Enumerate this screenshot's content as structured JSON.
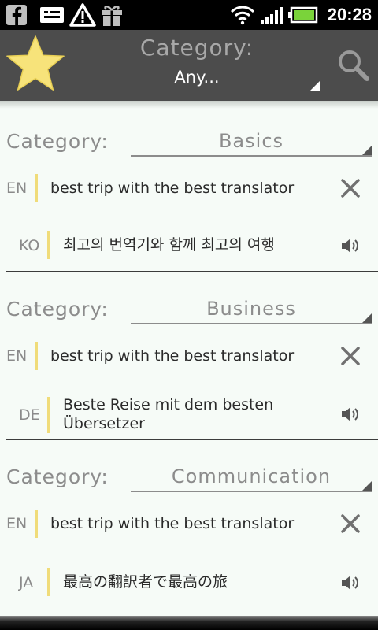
{
  "status_bar": {
    "time": "20:28",
    "icons": [
      "facebook-icon",
      "message-icon",
      "warning-icon",
      "gift-icon",
      "wifi-icon",
      "signal-icon",
      "battery-icon"
    ]
  },
  "header": {
    "label": "Category:",
    "selected": "Any...",
    "favorite_icon": "star-icon",
    "search_icon": "search-icon"
  },
  "colors": {
    "header_bg": "#4c4c4c",
    "star": "#f7e37a",
    "accent_bar": "#f0dc7a",
    "background": "#f6fbf7"
  },
  "entries": [
    {
      "category_label": "Category:",
      "category": "Basics",
      "source_lang": "EN",
      "source_text": "best trip with the best translator",
      "target_lang": "KO",
      "target_text": "최고의 번역기와 함께 최고의 여행"
    },
    {
      "category_label": "Category:",
      "category": "Business",
      "source_lang": "EN",
      "source_text": "best trip with the best translator",
      "target_lang": "DE",
      "target_text_line1": "Beste Reise mit dem besten",
      "target_text_line2": "Übersetzer"
    },
    {
      "category_label": "Category:",
      "category": "Communication",
      "source_lang": "EN",
      "source_text": "best trip with the best translator",
      "target_lang": "JA",
      "target_text": "最高の翻訳者で最高の旅"
    }
  ]
}
